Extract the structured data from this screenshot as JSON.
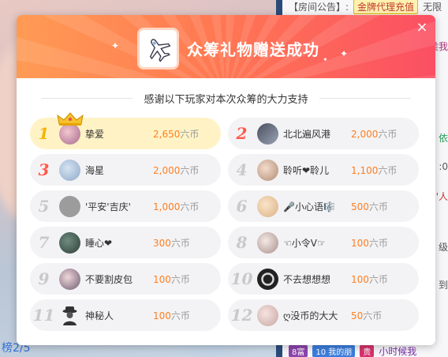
{
  "background": {
    "notice_label": "【房间公告】:",
    "gold_badge": "金牌代理充值",
    "side_texts": [
      "无限",
      "侯我",
      "依",
      ":0",
      "官'人",
      "级",
      "到"
    ],
    "bottom_left_text": "榜2/5",
    "bottom_chips": [
      "8富",
      "10 我的朋",
      "贵",
      "小时候我"
    ]
  },
  "modal": {
    "title": "众筹礼物赠送成功",
    "subtitle": "感谢以下玩家对本次众筹的大力支持",
    "close_label": "×",
    "accent_color": "#ff7a52"
  },
  "supporters": [
    {
      "rank": "1",
      "name": "挚爱",
      "amount": "2,650",
      "unit": "六币"
    },
    {
      "rank": "2",
      "name": "北北遍风港",
      "amount": "2,000",
      "unit": "六币"
    },
    {
      "rank": "3",
      "name": "海星",
      "amount": "2,000",
      "unit": "六币"
    },
    {
      "rank": "4",
      "name": "聆听❤聆儿",
      "amount": "1,100",
      "unit": "六币"
    },
    {
      "rank": "5",
      "name": "'平安'吉庆'",
      "amount": "1,000",
      "unit": "六币"
    },
    {
      "rank": "6",
      "name": "🎤小心语🎼",
      "amount": "500",
      "unit": "六币"
    },
    {
      "rank": "7",
      "name": "睡心❤",
      "amount": "300",
      "unit": "六币"
    },
    {
      "rank": "8",
      "name": "☜小令V☞",
      "amount": "100",
      "unit": "六币"
    },
    {
      "rank": "9",
      "name": "不要割皮包",
      "amount": "100",
      "unit": "六币"
    },
    {
      "rank": "10",
      "name": "不去想想想",
      "amount": "100",
      "unit": "六币"
    },
    {
      "rank": "11",
      "name": "神秘人",
      "amount": "100",
      "unit": "六币"
    },
    {
      "rank": "12",
      "name": "ღ没币的大大",
      "amount": "50",
      "unit": "六币"
    }
  ]
}
